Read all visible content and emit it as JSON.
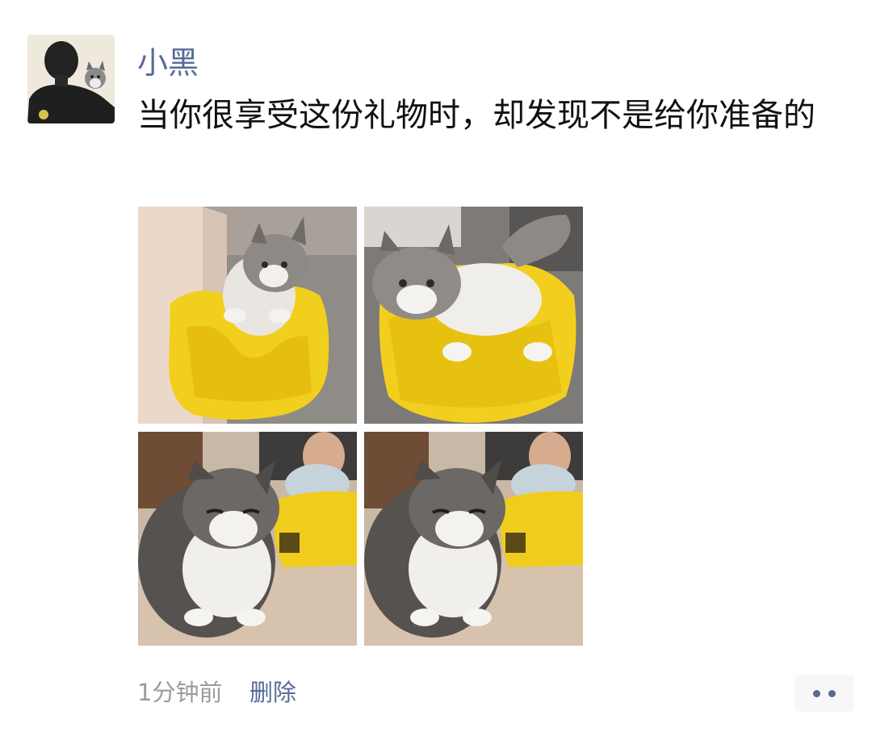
{
  "post": {
    "author": "小黑",
    "text": "当你很享受这份礼物时，却发现不是给你准备的",
    "time": "1分钟前",
    "delete_label": "删除"
  },
  "images": [
    {
      "name": "cat-in-yellow-seat-1"
    },
    {
      "name": "cat-in-yellow-seat-2"
    },
    {
      "name": "cat-beside-baby-seat-1"
    },
    {
      "name": "cat-beside-baby-seat-2"
    }
  ],
  "icons": {
    "more": "more-dots-icon"
  },
  "colors": {
    "link": "#576b95",
    "text": "#111111",
    "meta": "#9b9b9b",
    "seat_yellow": "#f2d01e"
  }
}
